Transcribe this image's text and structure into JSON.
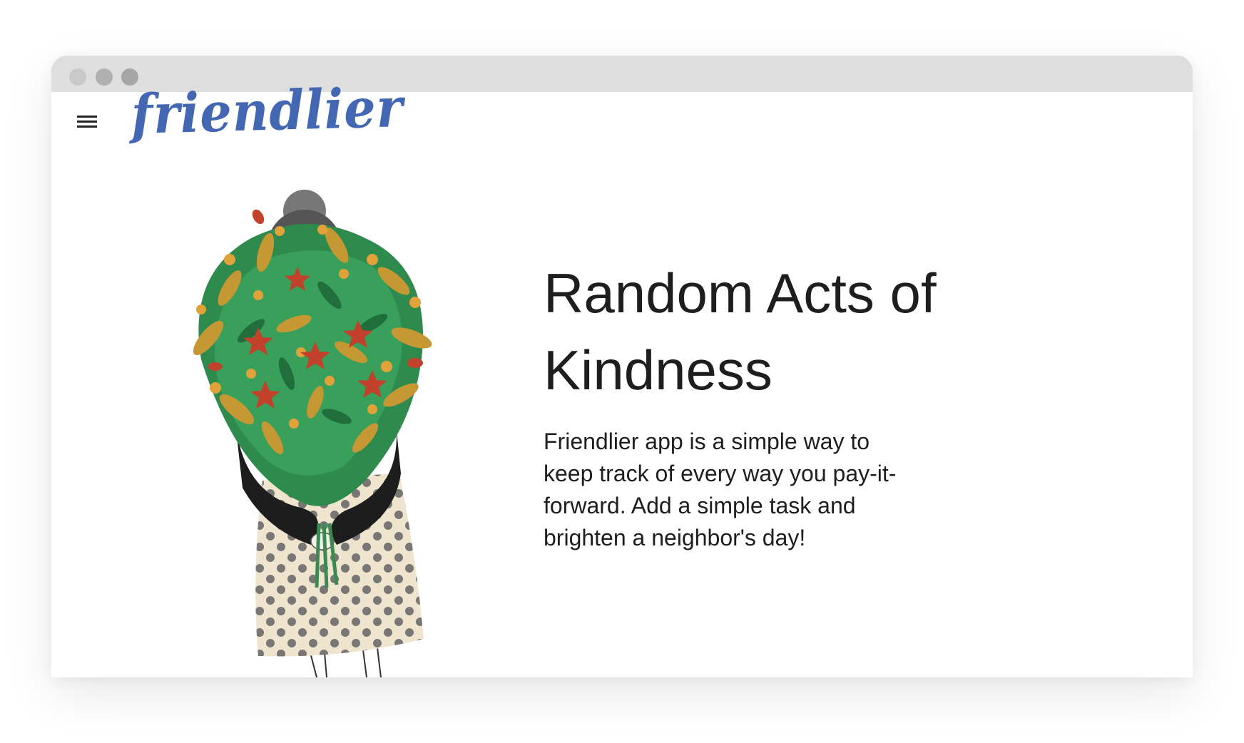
{
  "app": {
    "logo_text": "friendlier",
    "brand_color": "#4467b3"
  },
  "header": {
    "menu_icon": "hamburger-menu-icon"
  },
  "hero": {
    "title_line1": "Random Acts of",
    "title_line2": "Kindness",
    "description": "Friendlier app is a simple way to keep track of every way you pay-it-forward. Add a simple task and brighten a neighbor's day!",
    "illustration": "woman-holding-flower-bouquet-illustration"
  }
}
